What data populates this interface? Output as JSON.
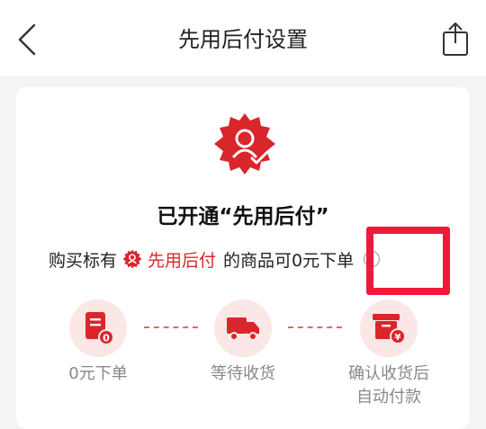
{
  "header": {
    "title": "先用后付设置",
    "back_icon": "chevron-left-icon",
    "share_icon": "share-icon"
  },
  "status": {
    "badge_icon": "badge-check-icon",
    "title": "已开通“先用后付”"
  },
  "description": {
    "prefix": "购买标有",
    "brand": "先用后付",
    "suffix": "的商品可0元下单",
    "info_icon": "info-icon"
  },
  "steps": [
    {
      "icon": "document-zero-icon",
      "label": "0元下单"
    },
    {
      "icon": "delivery-truck-icon",
      "label": "等待收货"
    },
    {
      "icon": "box-yuan-icon",
      "label": "确认收货后\n自动付款"
    }
  ],
  "colors": {
    "accent": "#d8262b",
    "step_bg": "#fbe7e5",
    "highlight": "#f0193a"
  }
}
